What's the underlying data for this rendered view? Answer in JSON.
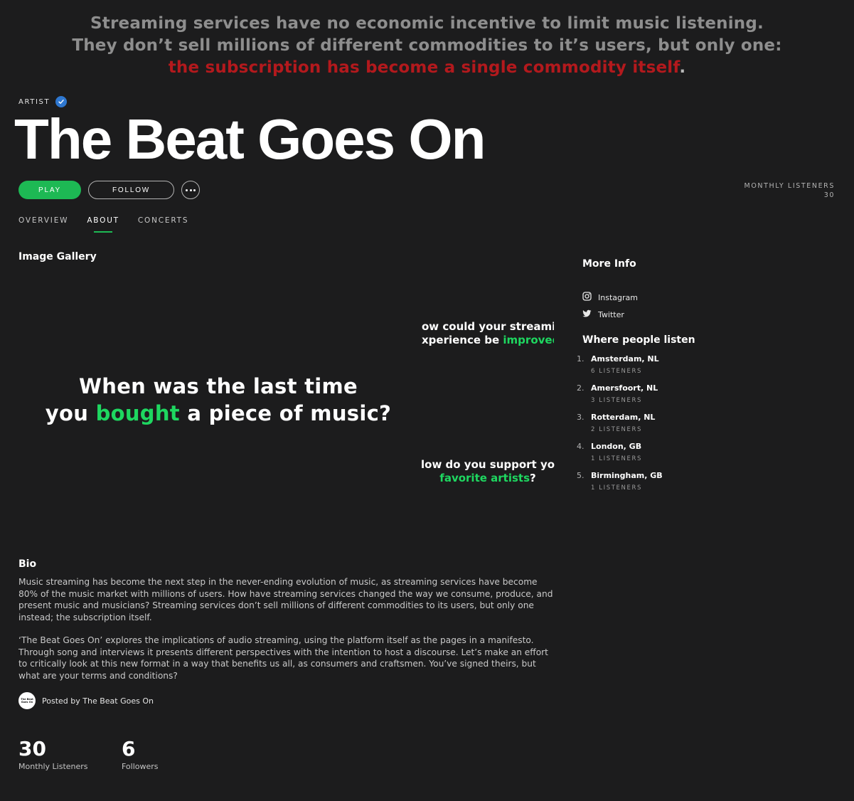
{
  "banner": {
    "line1": "Streaming services have no economic incentive to limit music listening.",
    "line2": "They don’t sell millions of different commodities to it’s users, but only one:",
    "line3_red": "the subscription has become a single commodity itself",
    "line3_end": "."
  },
  "header": {
    "type_label": "ARTIST",
    "artist_name": "The Beat Goes On",
    "play_label": "PLAY",
    "follow_label": "FOLLOW",
    "monthly_label": "MONTHLY LISTENERS",
    "monthly_value": "30"
  },
  "tabs": [
    {
      "label": "OVERVIEW"
    },
    {
      "label": "ABOUT"
    },
    {
      "label": "CONCERTS"
    }
  ],
  "gallery": {
    "title": "Image Gallery",
    "main_line1": "When was the last time",
    "main_line2_a": "you ",
    "main_line2_green": "bought",
    "main_line2_b": " a piece of music?",
    "q1_line1": "ow could your streamin",
    "q1_line2_a": "xperience be ",
    "q1_line2_green": "improved",
    "q2_line1": "low do you support you",
    "q2_line2_green": "favorite artists",
    "q2_line2_end": "?"
  },
  "more_info": {
    "title": "More Info",
    "instagram": "Instagram",
    "twitter": "Twitter",
    "where_title": "Where people listen",
    "cities": [
      {
        "rank": "1.",
        "name": "Amsterdam, NL",
        "count": "6 LISTENERS"
      },
      {
        "rank": "2.",
        "name": "Amersfoort, NL",
        "count": "3 LISTENERS"
      },
      {
        "rank": "3.",
        "name": "Rotterdam, NL",
        "count": "2 LISTENERS"
      },
      {
        "rank": "4.",
        "name": "London, GB",
        "count": "1 LISTENERS"
      },
      {
        "rank": "5.",
        "name": "Birmingham, GB",
        "count": "1 LISTENERS"
      }
    ]
  },
  "bio": {
    "title": "Bio",
    "para1": "Music streaming has become the next step in the never-ending evolution of music, as streaming services have become 80% of the music market with millions of users. How have streaming services changed the way we consume, produce, and present music and musicians? Streaming services don’t sell millions of different commodities to its users, but only one instead; the subscription itself.",
    "para2": "‘The Beat Goes On’ explores the implications of audio streaming, using the platform itself as the pages in a manifesto. Through song and interviews it presents different perspectives with the intention to host a discourse. Let’s make an effort to critically look at this new format in a way that benefits us all, as consumers and craftsmen. You’ve signed theirs, but what are your terms and conditions?",
    "posted_by": "Posted by The Beat Goes On",
    "avatar_text": "The Beat Goes On"
  },
  "stats": {
    "listeners_value": "30",
    "listeners_label": "Monthly Listeners",
    "followers_value": "6",
    "followers_label": "Followers"
  },
  "colors": {
    "background": "#1c1c1d",
    "accent_green": "#1db954",
    "banner_red": "#b3191d",
    "verified_blue": "#2e77d0"
  }
}
